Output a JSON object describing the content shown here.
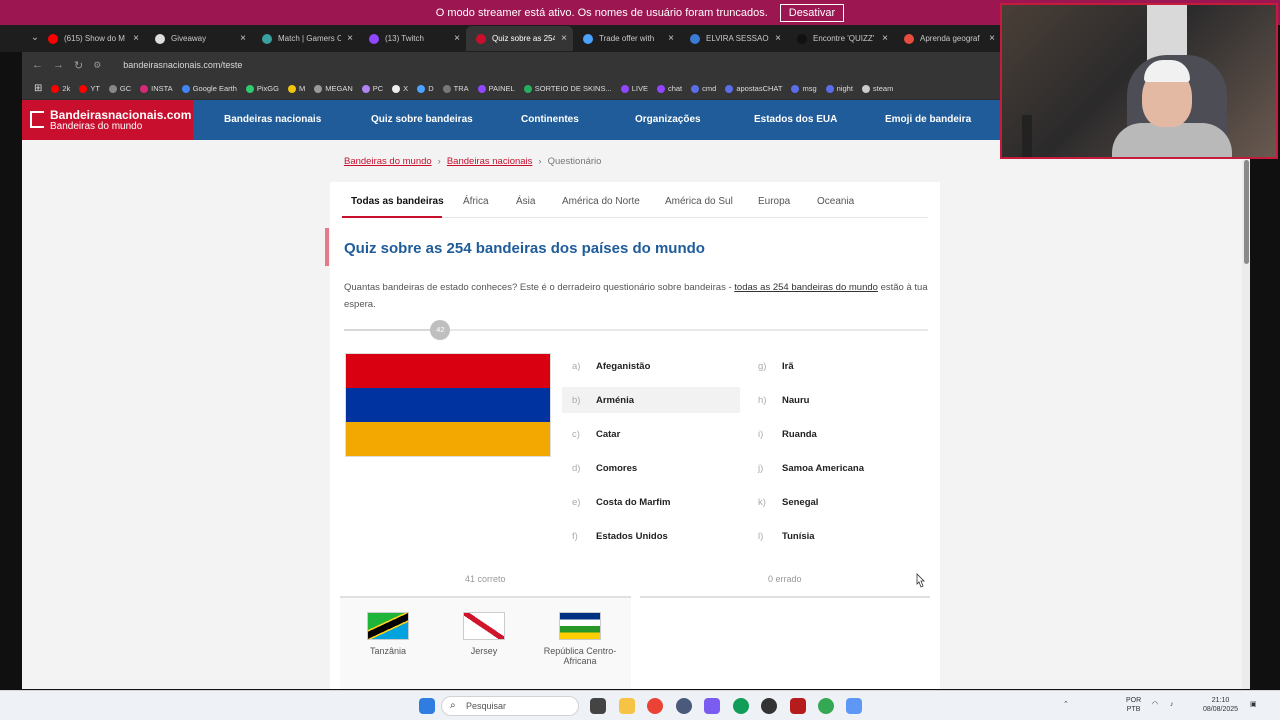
{
  "streamer_banner": {
    "message": "O modo streamer está ativo. Os nomes de usuário foram truncados.",
    "button": "Desativar"
  },
  "browser": {
    "tabs": [
      {
        "label": "(615) Show do M",
        "color": "#ff0000",
        "active": false
      },
      {
        "label": "Giveaway",
        "color": "#dddddd",
        "active": false
      },
      {
        "label": "Match | Gamers C",
        "color": "#3aa0a0",
        "active": false
      },
      {
        "label": "(13) Twitch",
        "color": "#9146ff",
        "active": false
      },
      {
        "label": "Quiz sobre as 254",
        "color": "#c8102e",
        "active": true
      },
      {
        "label": "Trade offer with",
        "color": "#4aa3ff",
        "active": false
      },
      {
        "label": "ELVIRA SESSAO U",
        "color": "#3a7bd5",
        "active": false
      },
      {
        "label": "Encontre 'QUIZZ'",
        "color": "#111111",
        "active": false
      },
      {
        "label": "Aprenda geograf",
        "color": "#e74c3c",
        "active": false
      }
    ],
    "url": "bandeirasnacionais.com/teste",
    "bookmarks": [
      {
        "label": "2k",
        "color": "#ff0000"
      },
      {
        "label": "YT",
        "color": "#ff0000"
      },
      {
        "label": "GC",
        "color": "#888888"
      },
      {
        "label": "INSTA",
        "color": "#d62976"
      },
      {
        "label": "Google Earth",
        "color": "#4285f4"
      },
      {
        "label": "PixGG",
        "color": "#2ecc71"
      },
      {
        "label": "M",
        "color": "#f1c40f"
      },
      {
        "label": "MEGAN",
        "color": "#999999"
      },
      {
        "label": "PC",
        "color": "#b084f5"
      },
      {
        "label": "X",
        "color": "#eeeeee"
      },
      {
        "label": "D",
        "color": "#4aa3ff"
      },
      {
        "label": "TRA",
        "color": "#777777"
      },
      {
        "label": "PAINEL",
        "color": "#9146ff"
      },
      {
        "label": "SORTEIO DE SKINS...",
        "color": "#27ae60"
      },
      {
        "label": "LIVE",
        "color": "#9146ff"
      },
      {
        "label": "chat",
        "color": "#9146ff"
      },
      {
        "label": "cmd",
        "color": "#5b6eea"
      },
      {
        "label": "apostasCHAT",
        "color": "#5b6eea"
      },
      {
        "label": "msg",
        "color": "#5b6eea"
      },
      {
        "label": "night",
        "color": "#5b6eea"
      },
      {
        "label": "steam",
        "color": "#cccccc"
      }
    ]
  },
  "site": {
    "logo_title": "Bandeirasnacionais.com",
    "logo_sub": "Bandeiras do mundo",
    "nav": [
      "Bandeiras nacionais",
      "Quiz sobre bandeiras",
      "Continentes",
      "Organizações",
      "Estados dos EUA",
      "Emoji de bandeira"
    ],
    "breadcrumb": [
      "Bandeiras do mundo",
      "Bandeiras nacionais",
      "Questionário"
    ],
    "region_tabs": [
      "Todas as bandeiras",
      "África",
      "Ásia",
      "América do Norte",
      "América do Sul",
      "Europa",
      "Oceania"
    ],
    "quiz_title": "Quiz sobre as 254 bandeiras dos países do mundo",
    "desc_before": "Quantas bandeiras de estado conheces? Este é o derradeiro questionário sobre bandeiras - ",
    "desc_link": "todas as 254 bandeiras do mundo",
    "desc_after": " estão à tua espera.",
    "progress": {
      "current": "42",
      "fraction": 0.165
    },
    "flag_colors": [
      "#d90012",
      "#0033a0",
      "#f2a800"
    ],
    "options": [
      {
        "letter": "a)",
        "label": "Afeganistão"
      },
      {
        "letter": "b)",
        "label": "Arménia"
      },
      {
        "letter": "c)",
        "label": "Catar"
      },
      {
        "letter": "d)",
        "label": "Comores"
      },
      {
        "letter": "e)",
        "label": "Costa do Marfim"
      },
      {
        "letter": "f)",
        "label": "Estados Unidos"
      },
      {
        "letter": "g)",
        "label": "Irã"
      },
      {
        "letter": "h)",
        "label": "Nauru"
      },
      {
        "letter": "i)",
        "label": "Ruanda"
      },
      {
        "letter": "j)",
        "label": "Samoa Americana"
      },
      {
        "letter": "k)",
        "label": "Senegal"
      },
      {
        "letter": "l)",
        "label": "Tunísia"
      }
    ],
    "correct_label": "41 correto",
    "wrong_label": "0 errado",
    "correct_flags": [
      {
        "name": "Tanzânia"
      },
      {
        "name": "Jersey"
      },
      {
        "name": "República Centro-Africana"
      }
    ]
  },
  "taskbar": {
    "search_placeholder": "Pesquisar",
    "lang_1": "POR",
    "lang_2": "PTB",
    "time": "21:10",
    "date": "08/08/2025"
  }
}
